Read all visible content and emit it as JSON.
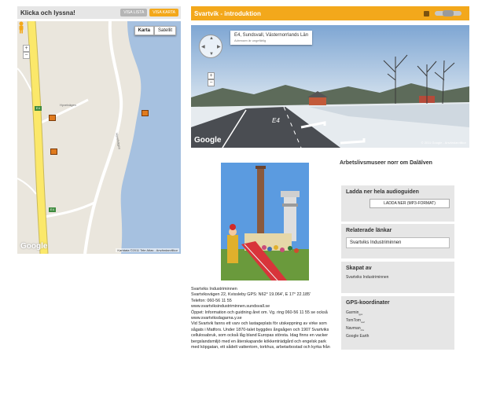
{
  "left": {
    "title": "Klicka och lyssna!",
    "btn_list": "VISA LISTA",
    "btn_map": "VISA KARTA"
  },
  "map": {
    "type_map": "Karta",
    "type_satellite": "Satellit",
    "zoom_in": "+",
    "zoom_out": "−",
    "road_shield": "E4",
    "road_label_1": "Hyvelvägen",
    "road_label_2": "Hyvelvägen",
    "logo": "Google",
    "copyright": "Kartdata ©2011 Tele Atlas - Användarvillkor",
    "colors": {
      "water": "#a6c1e0",
      "land": "#eae6dd",
      "highway": "#fbe86a",
      "road": "#ffffff",
      "marker": "#e07b1e"
    }
  },
  "right": {
    "title": "Svartvik - introduktion"
  },
  "streetview": {
    "address": "E4, Sundsvall, Västernorrlands Län",
    "sub": "Adressen är ungefärlig",
    "road": "E4",
    "logo": "Google",
    "copyright": "© 2011 Google - Användarvillkor",
    "nav_up": "▲",
    "nav_down": "▼",
    "nav_left": "◀",
    "nav_right": "▶",
    "zoom_in": "+",
    "zoom_out": "−"
  },
  "description": {
    "lines": [
      "Svartviks Industriminnen",
      "Svartviksvägen 22, Kvissleby GPS: N62° 19.064', E 17° 22.185'",
      "Telefon: 060-56 11 55",
      "www.svartviksindustriminnen.sundsvall.se",
      "Öppet: Information och guidning året om. Vg. ring 060-56 11 55 se också",
      "www.svartviksdagarna.y.se",
      "Vid Svartvik fanns ett varv och lastageplats för utskeppning av virke som sågats i Matfors. Under 1870-talet byggdes ångsågen och 1907 Svartviks cellulosabruk, som också låg bland Europas största. Idag finns en vacker bergslandsmiljö med en återskapande kökkenträdgård och engelsk park med köpgatan, ett sådelt vattentorn, torkhus, arbetarbostad och kyrka från"
    ]
  },
  "sidebar": {
    "title": "Arbetslivsmuseer norr om Dalälven",
    "download_heading": "Ladda ner hela audioguiden",
    "download_button": "LADDA NER (MP3-FORMAT)",
    "links_heading": "Relaterade länkar",
    "link_text": "Svartviks Industriminnen",
    "created_heading": "Skapat av",
    "created_text": "Svartviks Industriminnen",
    "gps_heading": "GPS-koordinater",
    "gps_items": [
      {
        "name": "Garmin",
        "ext": "gpx"
      },
      {
        "name": "TomTom",
        "ext": "ov2"
      },
      {
        "name": "Navman",
        "ext": "csv"
      },
      {
        "name": "Google Earth",
        "ext": ""
      }
    ]
  }
}
